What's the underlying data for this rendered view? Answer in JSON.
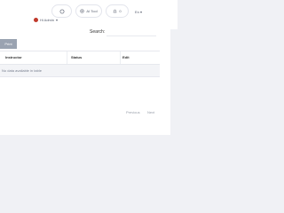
{
  "topbar": {
    "visit_site": "Visit Site",
    "ai_tool": "AI Tool",
    "notifications_count": "0",
    "language": "En",
    "user_label": "Hi Admin"
  },
  "toolbar": {
    "search_label": "Search:",
    "search_value": "",
    "print_label": "Print"
  },
  "table": {
    "columns": [
      "Instructor",
      "Status",
      "Edit"
    ],
    "empty_message": "No data available in table"
  },
  "pagination": {
    "previous": "Previous",
    "next": "Next"
  },
  "colors": {
    "accent": "#9aa3b1",
    "avatar": "#c0392b"
  }
}
